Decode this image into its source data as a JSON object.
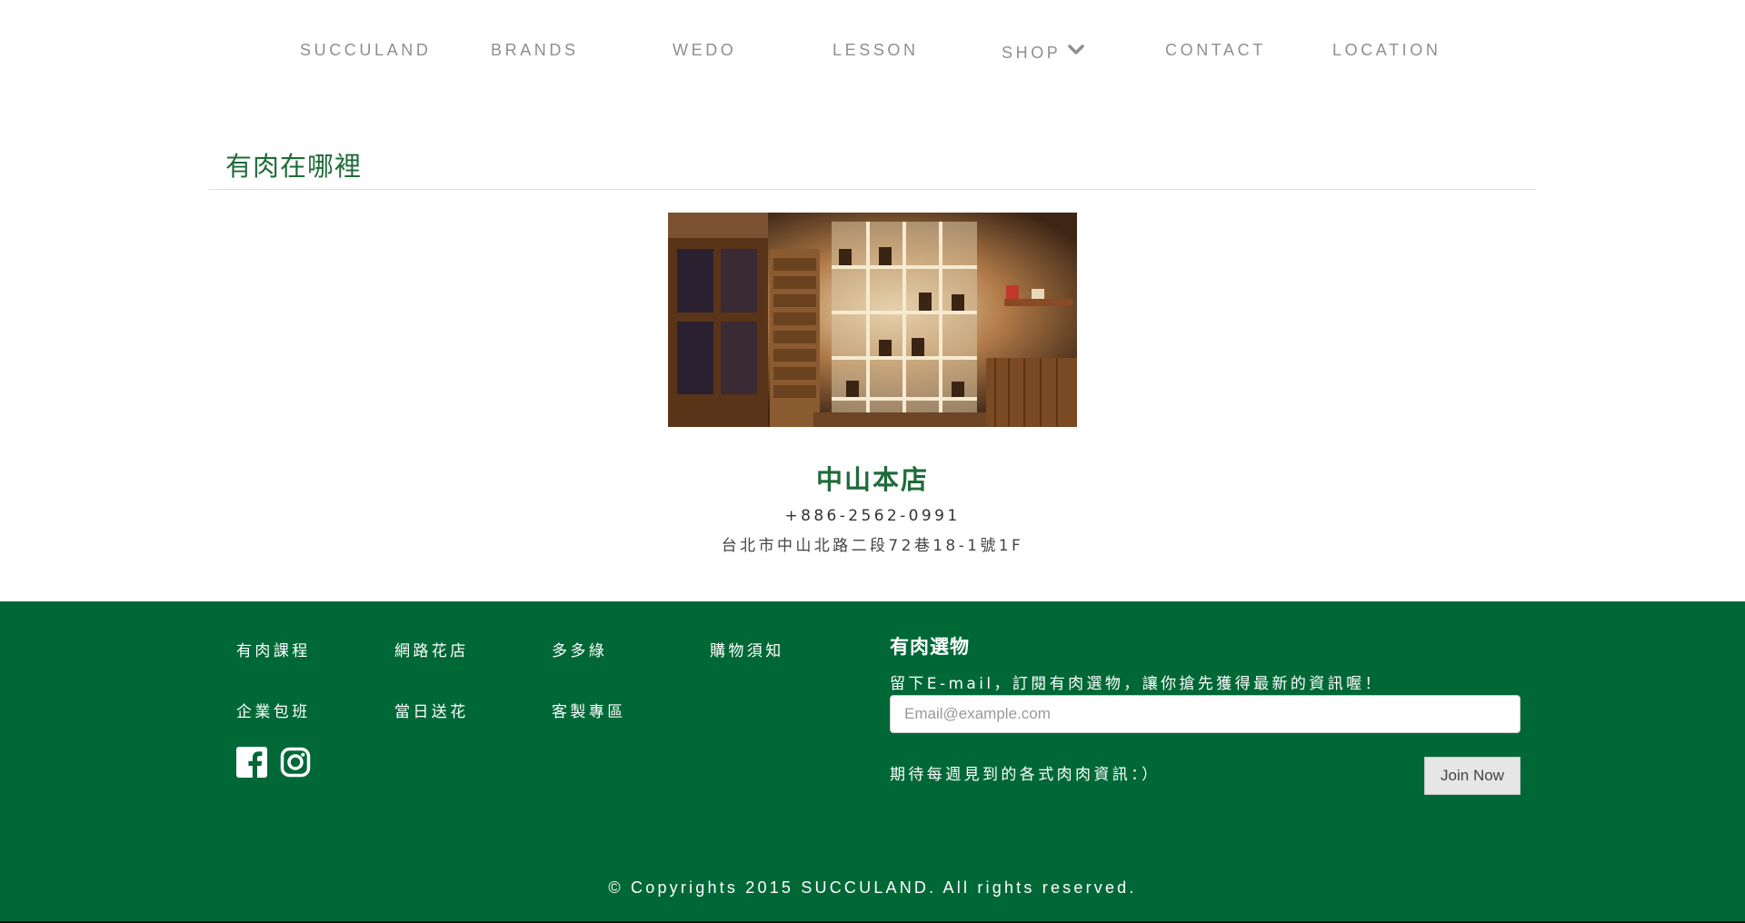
{
  "nav": {
    "items": [
      {
        "label": "SUCCULAND"
      },
      {
        "label": "BRANDS"
      },
      {
        "label": "WEDO"
      },
      {
        "label": "LESSON"
      },
      {
        "label": "SHOP"
      },
      {
        "label": "CONTACT"
      },
      {
        "label": "LOCATION"
      }
    ],
    "shop_icon": "chevron-down-icon"
  },
  "section": {
    "title": "有肉在哪裡"
  },
  "store": {
    "photo_icon": "store-interior-photo",
    "name": "中山本店",
    "phone": "+886-2562-0991",
    "address": "台北市中山北路二段72巷18-1號1F"
  },
  "footer": {
    "links": [
      {
        "label": "有肉課程"
      },
      {
        "label": "網路花店"
      },
      {
        "label": "多多綠"
      },
      {
        "label": "購物須知"
      },
      {
        "label": "企業包班"
      },
      {
        "label": "當日送花"
      },
      {
        "label": "客製專區"
      }
    ],
    "social": [
      "facebook-icon",
      "instagram-icon"
    ],
    "newsletter": {
      "title": "有肉選物",
      "description": "留下E-mail，訂閱有肉選物，讓你搶先獲得最新的資訊喔！",
      "placeholder": "Email@example.com",
      "note": "期待每週見到的各式肉肉資訊：）",
      "button": "Join Now"
    },
    "copyright": "© Copyrights 2015 SUCCULAND. All rights reserved."
  },
  "colors": {
    "brand_green": "#006837",
    "heading_green": "#1f6b3a",
    "nav_gray": "#8f8f8f"
  }
}
